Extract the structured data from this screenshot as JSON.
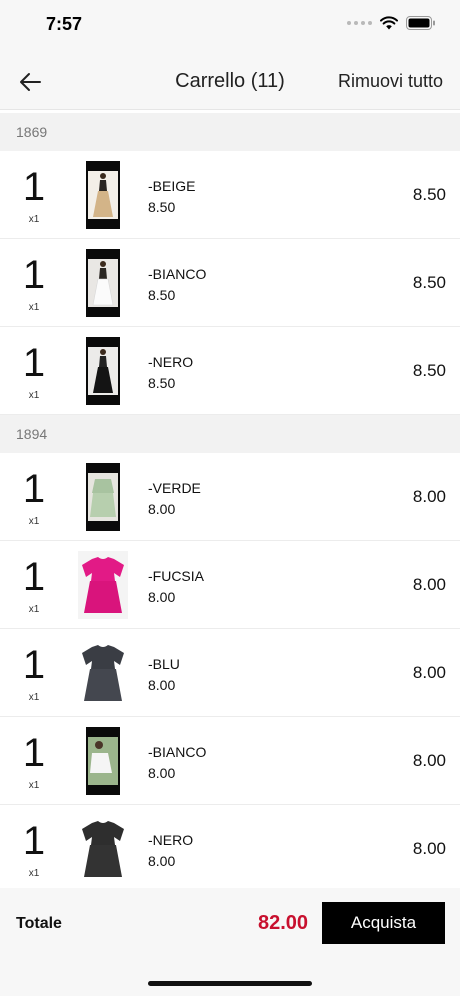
{
  "status_bar": {
    "time": "7:57"
  },
  "header": {
    "title": "Carrello (11)",
    "remove_all_label": "Rimuovi tutto"
  },
  "sections": [
    {
      "code": "1869",
      "items": [
        {
          "qty": "1",
          "qty_label": "x1",
          "name": "-BEIGE",
          "price": "8.50",
          "total": "8.50",
          "image": "beige-dress-photo"
        },
        {
          "qty": "1",
          "qty_label": "x1",
          "name": "-BIANCO",
          "price": "8.50",
          "total": "8.50",
          "image": "white-dress-photo"
        },
        {
          "qty": "1",
          "qty_label": "x1",
          "name": "-NERO",
          "price": "8.50",
          "total": "8.50",
          "image": "black-dress-photo"
        }
      ]
    },
    {
      "code": "1894",
      "items": [
        {
          "qty": "1",
          "qty_label": "x1",
          "name": "-VERDE",
          "price": "8.00",
          "total": "8.00",
          "image": "green-top-photo"
        },
        {
          "qty": "1",
          "qty_label": "x1",
          "name": "-FUCSIA",
          "price": "8.00",
          "total": "8.00",
          "image": "fuchsia-top-photo"
        },
        {
          "qty": "1",
          "qty_label": "x1",
          "name": "-BLU",
          "price": "8.00",
          "total": "8.00",
          "image": "blue-top-photo"
        },
        {
          "qty": "1",
          "qty_label": "x1",
          "name": "-BIANCO",
          "price": "8.00",
          "total": "8.00",
          "image": "white-top-photo"
        },
        {
          "qty": "1",
          "qty_label": "x1",
          "name": "-NERO",
          "price": "8.00",
          "total": "8.00",
          "image": "black-top-photo"
        }
      ]
    }
  ],
  "footer": {
    "total_label": "Totale",
    "total_value": "82.00",
    "buy_label": "Acquista"
  },
  "colors": {
    "accent_total": "#c8102e",
    "buy_button_bg": "#000000",
    "section_header_bg": "#f2f2f2"
  }
}
